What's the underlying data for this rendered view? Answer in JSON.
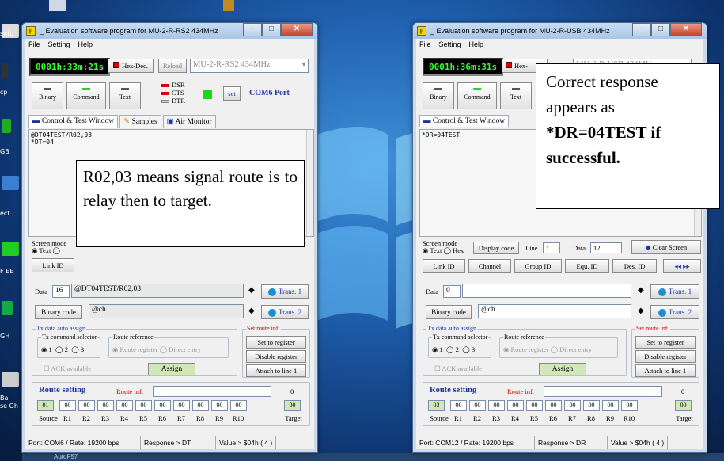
{
  "desktop": {
    "left_labels": [
      "setu",
      "cp",
      "GB",
      "ect",
      "F EE",
      "GH",
      "Bal",
      "se Gh"
    ],
    "taskbar_text": "AutoF57"
  },
  "left_window": {
    "title": "_ Evaluation software program for MU-2-R-RS2 434MHz",
    "menu": [
      "File",
      "Setting",
      "Help"
    ],
    "timer": "0001h:33m:21s",
    "hexdec": "Hex-Dec.",
    "reload": "Reload",
    "device": "MU-2-R-RS2 434MHz",
    "modes": [
      "Binary",
      "Command",
      "Text"
    ],
    "signals": [
      "DSR",
      "CTS",
      "DTR"
    ],
    "set": "set",
    "port": "COM6 Port",
    "tabs": [
      "Control & Test Window",
      "Samples",
      "Air Monitor"
    ],
    "console_lines": [
      "@DT04TEST/R02,03",
      "*DT=04"
    ],
    "screen_mode_label": "Screen mode",
    "screen_mode_text": "Text",
    "link_id": "Link ID",
    "data_label": "Data",
    "data_len": "16",
    "data_value": "@DT04TEST/R02,03",
    "trans1": "Trans. 1",
    "binary_code": "Binary code",
    "binary_value": "@ch",
    "trans2": "Trans. 2",
    "tx_auto": "Tx data auto assign",
    "tx_selector": "Tx command selector",
    "tx_options": [
      "1",
      "2",
      "3"
    ],
    "route_ref": "Route reference",
    "route_ref_options": [
      "Route register",
      "Direct entry"
    ],
    "ack": "ACK available",
    "assign": "Assign",
    "set_route": "Set route inf.",
    "set_to_register": "Set to register",
    "disable_register": "Disable register",
    "attach_line": "Attach to line 1",
    "route_setting": "Route setting",
    "route_inf": "Route inf.",
    "route_count": "0",
    "route_values": [
      "01",
      "00",
      "00",
      "00",
      "00",
      "00",
      "00",
      "00",
      "00",
      "00",
      "00",
      "00"
    ],
    "route_labels": [
      "Source",
      "R1",
      "R2",
      "R3",
      "R4",
      "R5",
      "R6",
      "R7",
      "R8",
      "R9",
      "R10",
      "Target"
    ],
    "status": [
      "Port: COM6 / Rate: 19200 bps",
      "Response > DT",
      "Value > $04h ( 4 )"
    ]
  },
  "right_window": {
    "title": "_ Evaluation software program for MU-2-R-USB 434MHz",
    "menu": [
      "File",
      "Setting",
      "Help"
    ],
    "timer": "0001h:36m:31s",
    "hexdec": "Hex-",
    "device": "MU-2-R-USB 434MHz",
    "modes": [
      "Binary",
      "Command",
      "Text"
    ],
    "tabs": [
      "Control & Test Window"
    ],
    "console_lines": [
      "*DR=04TEST"
    ],
    "screen_mode_label": "Screen mode",
    "screen_mode_text": "Text",
    "screen_mode_hex": "Hex",
    "display_code": "Display code",
    "line_label": "Line",
    "line_value": "1",
    "data_label_top": "Data",
    "data_count": "12",
    "clear_screen": "Clear Screen",
    "id_buttons": [
      "Link ID",
      "Channel",
      "Group ID",
      "Equ. ID",
      "Des. ID"
    ],
    "data_label": "Data",
    "data_len": "0",
    "data_value": "",
    "trans1": "Trans. 1",
    "binary_code": "Binary code",
    "binary_value": "@ch",
    "trans2": "Trans. 2",
    "tx_auto": "Tx data auto assign",
    "tx_selector": "Tx command selector",
    "tx_options": [
      "1",
      "2",
      "3"
    ],
    "route_ref": "Route reference",
    "route_ref_options": [
      "Route register",
      "Direct entry"
    ],
    "ack": "ACK available",
    "assign": "Assign",
    "set_route": "Set route inf.",
    "set_to_register": "Set to register",
    "disable_register": "Disable register",
    "attach_line": "Attach to line 1",
    "route_setting": "Route setting",
    "route_inf": "Route inf.",
    "route_count": "0",
    "route_values": [
      "03",
      "00",
      "00",
      "00",
      "00",
      "00",
      "00",
      "00",
      "00",
      "00",
      "00",
      "00"
    ],
    "route_labels": [
      "Source",
      "R1",
      "R2",
      "R3",
      "R4",
      "R5",
      "R6",
      "R7",
      "R8",
      "R9",
      "R10",
      "Target"
    ],
    "status": [
      "Port: COM12 / Rate: 19200 bps",
      "Response > DR",
      "Value > $04h ( 4 )"
    ]
  },
  "notes": {
    "left": "R02,03 means signal route is to relay then to target.",
    "right_normal": "Correct response appears as",
    "right_bold": "*DR=04TEST if successful."
  }
}
